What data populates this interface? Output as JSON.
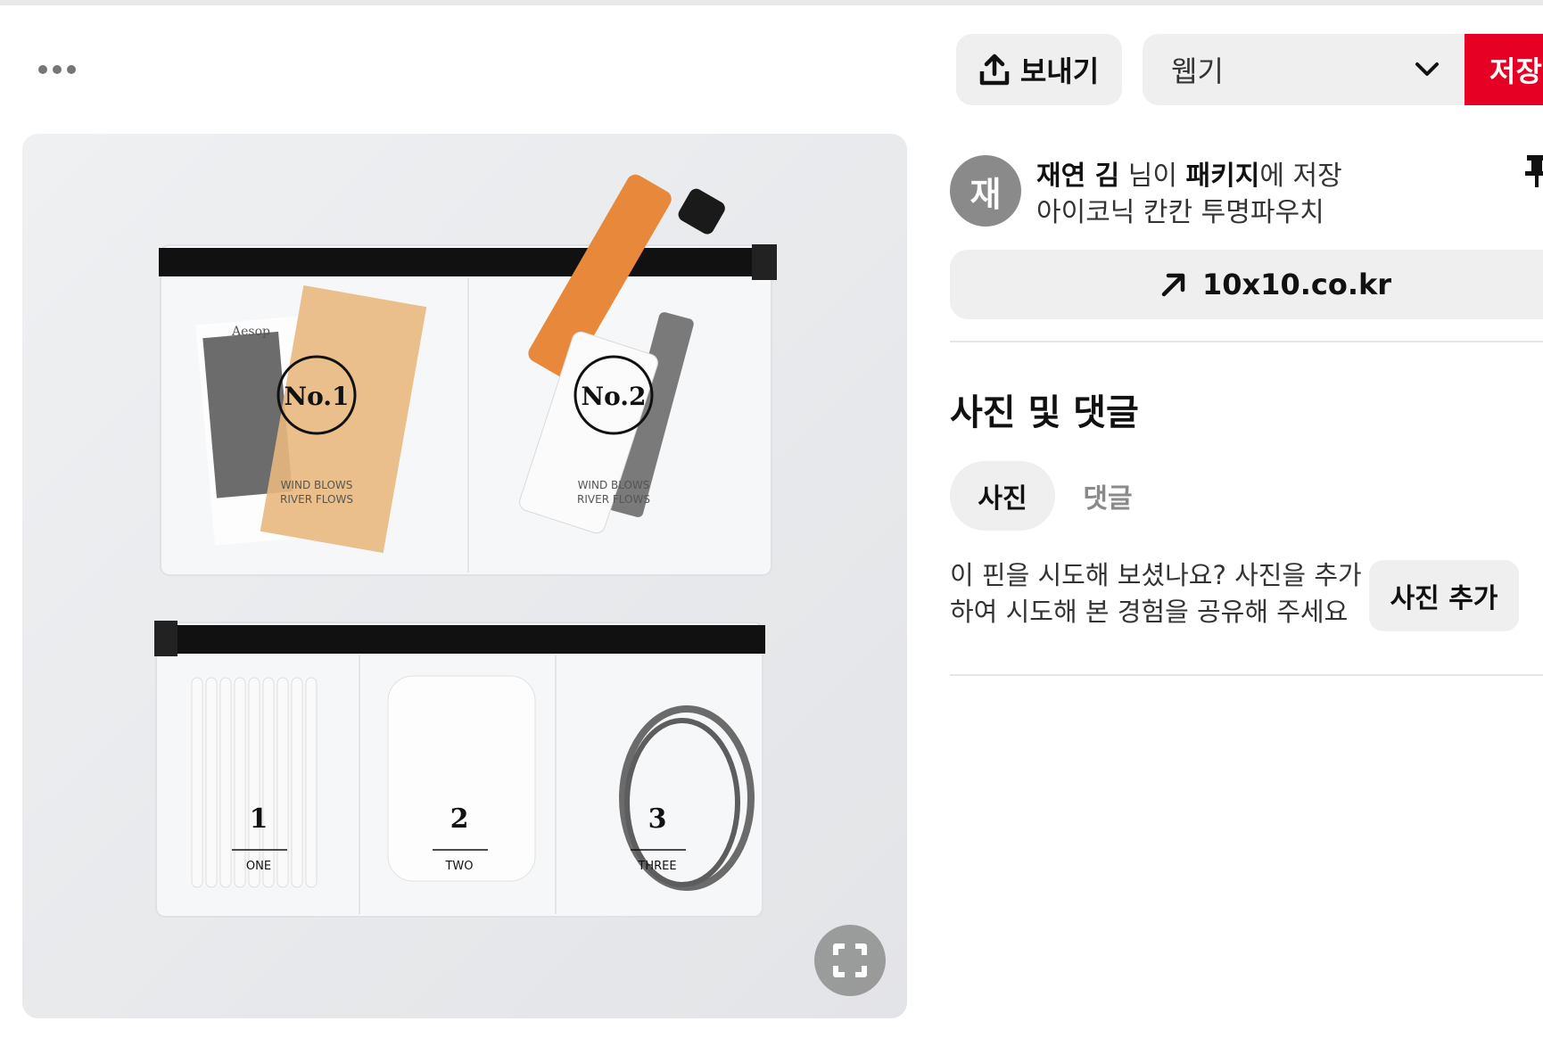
{
  "header": {
    "more_icon": "ellipsis-icon",
    "send_label": "보내기",
    "send_icon": "share-upload-icon",
    "board_name": "웹기",
    "board_icon": "chevron-down-icon",
    "save_label": "저장"
  },
  "pin": {
    "avatar_letter": "재",
    "saver_name": "재연 김",
    "saved_middle": " 님이 ",
    "board": "패키지",
    "saved_suffix": "에 저장",
    "title": "아이코닉 칸칸 투명파우치",
    "pin_icon": "pushpin-icon",
    "source_icon": "arrow-up-right-icon",
    "source_domain": "10x10.co.kr",
    "zoom_icon": "fullscreen-icon"
  },
  "photo": {
    "no1_label": "No.1",
    "no2_label": "No.2",
    "slogan_line1": "WIND BLOWS",
    "slogan_line2": "RIVER FLOWS",
    "brand": "Aesop",
    "pocket1_number": "1",
    "pocket1_word": "ONE",
    "pocket2_number": "2",
    "pocket2_word": "TWO",
    "pocket3_number": "3",
    "pocket3_word": "THREE"
  },
  "photos_section": {
    "title": "사진 및 댓글",
    "tabs": [
      {
        "label": "사진",
        "active": true
      },
      {
        "label": "댓글",
        "active": false
      }
    ],
    "prompt": "이 핀을 시도해 보셨나요? 사진을 추가하여 시도해 본 경험을 공유해 주세요",
    "add_photo_label": "사진 추가"
  },
  "colors": {
    "save_red": "#e60023",
    "button_gray": "#efefef",
    "avatar_gray": "#8a8a8a"
  }
}
